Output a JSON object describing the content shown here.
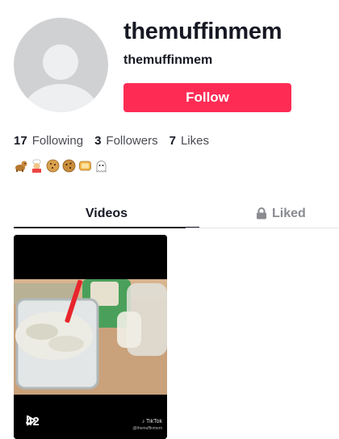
{
  "profile": {
    "name": "themuffinmem",
    "handle": "themuffinmem",
    "follow_label": "Follow",
    "accent": "#fe2c55"
  },
  "stats": [
    {
      "count": "17",
      "label": "Following"
    },
    {
      "count": "3",
      "label": "Followers"
    },
    {
      "count": "7",
      "label": "Likes"
    }
  ],
  "bio_emojis": [
    "dog-emoji",
    "cook-emoji",
    "cookie-emoji",
    "cookie-emoji",
    "bread-emoji",
    "ghost-emoji"
  ],
  "tabs": {
    "videos": "Videos",
    "liked": "Liked"
  },
  "videos": [
    {
      "views": "42",
      "watermark": "TikTok",
      "watermark_handle": "@themuffinmem"
    }
  ]
}
